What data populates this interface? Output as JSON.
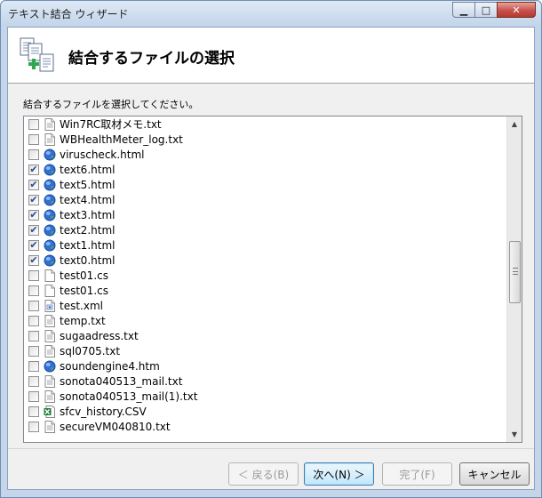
{
  "window": {
    "title": "テキスト結合 ウィザード",
    "minimize_glyph": "▁",
    "maximize_glyph": "□",
    "close_glyph": "✕"
  },
  "header": {
    "title": "結合するファイルの選択",
    "icon": "merge-documents-icon"
  },
  "instruction": "結合するファイルを選択してください。",
  "file_list": {
    "items": [
      {
        "name": "Win7RC取材メモ.txt",
        "checked": false,
        "icon": "text"
      },
      {
        "name": "WBHealthMeter_log.txt",
        "checked": false,
        "icon": "text"
      },
      {
        "name": "viruscheck.html",
        "checked": false,
        "icon": "html"
      },
      {
        "name": "text6.html",
        "checked": true,
        "icon": "html"
      },
      {
        "name": "text5.html",
        "checked": true,
        "icon": "html"
      },
      {
        "name": "text4.html",
        "checked": true,
        "icon": "html"
      },
      {
        "name": "text3.html",
        "checked": true,
        "icon": "html"
      },
      {
        "name": "text2.html",
        "checked": true,
        "icon": "html"
      },
      {
        "name": "text1.html",
        "checked": true,
        "icon": "html"
      },
      {
        "name": "text0.html",
        "checked": true,
        "icon": "html"
      },
      {
        "name": "test01.cs",
        "checked": false,
        "icon": "blank"
      },
      {
        "name": "test01.cs",
        "checked": false,
        "icon": "blank"
      },
      {
        "name": "test.xml",
        "checked": false,
        "icon": "xml"
      },
      {
        "name": "temp.txt",
        "checked": false,
        "icon": "text"
      },
      {
        "name": "sugaadress.txt",
        "checked": false,
        "icon": "text"
      },
      {
        "name": "sql0705.txt",
        "checked": false,
        "icon": "text"
      },
      {
        "name": "soundengine4.htm",
        "checked": false,
        "icon": "html"
      },
      {
        "name": "sonota040513_mail.txt",
        "checked": false,
        "icon": "text"
      },
      {
        "name": "sonota040513_mail(1).txt",
        "checked": false,
        "icon": "text"
      },
      {
        "name": "sfcv_history.CSV",
        "checked": false,
        "icon": "excel"
      },
      {
        "name": "secureVM040810.txt",
        "checked": false,
        "icon": "text"
      }
    ],
    "check_glyph": "✔",
    "scroll_up_glyph": "▲",
    "scroll_down_glyph": "▼"
  },
  "buttons": {
    "back": "＜ 戻る(B)",
    "next": "次へ(N) ＞",
    "finish": "完了(F)",
    "cancel": "キャンセル"
  },
  "colors": {
    "html_globe": "#2f6fd6",
    "excel_green": "#1f7a3a",
    "check": "#2a4a8a"
  }
}
